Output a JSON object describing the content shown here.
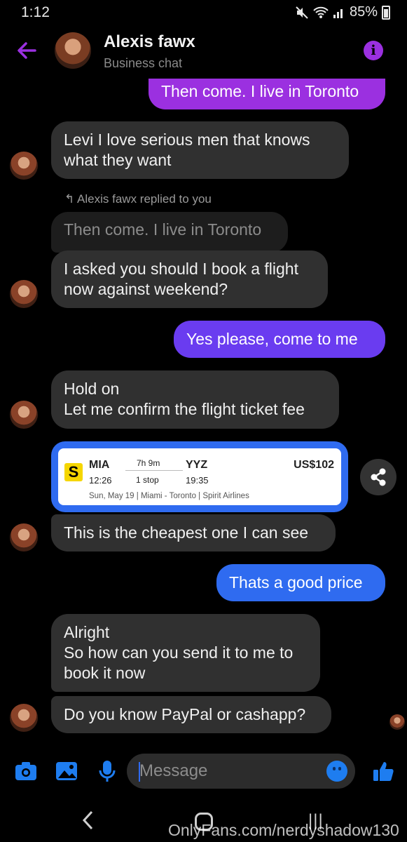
{
  "status_bar": {
    "time": "1:12",
    "battery": "85%"
  },
  "header": {
    "name": "Alexis fawx",
    "subtitle": "Business chat"
  },
  "messages": [
    {
      "text": "Then come. I live in Toronto",
      "dir": "out"
    },
    {
      "text": "Levi I love serious men that knows what they want",
      "dir": "in"
    },
    {
      "reply_note": "Alexis fawx replied to you",
      "quoted": "Then come. I live in Toronto",
      "text": "I asked you should I book a flight now against weekend?",
      "dir": "in"
    },
    {
      "text": "Yes please,  come to me",
      "dir": "out"
    },
    {
      "text_line1": "Hold on",
      "text_line2": "Let me confirm the flight ticket fee",
      "dir": "in"
    },
    {
      "text": "This is the cheapest one I can see",
      "dir": "in"
    },
    {
      "text": "Thats a good price",
      "dir": "out"
    },
    {
      "text_line1": "Alright",
      "text_line2": "So how can you send it to me to book it now",
      "dir": "in"
    },
    {
      "text": "Do you know PayPal or cashapp?",
      "dir": "in"
    }
  ],
  "flight_card": {
    "airline_logo": "S",
    "from": "MIA",
    "depart": "12:26",
    "duration": "7h 9m",
    "stops": "1 stop",
    "to": "YYZ",
    "arrive": "19:35",
    "price": "US$102",
    "details": "Sun, May 19  |  Miami - Toronto  |  Spirit Airlines"
  },
  "composer": {
    "placeholder": "Message"
  },
  "watermark": "OnlyFans.com/nerdyshadow130",
  "colors": {
    "purple": "#9b30e0",
    "violet": "#6a3cf0",
    "blue": "#2f6bf0",
    "incoming": "#303030"
  },
  "icons": [
    "back-arrow-icon",
    "info-icon",
    "share-icon",
    "camera-icon",
    "image-icon",
    "mic-icon",
    "emoji-icon",
    "like-icon"
  ]
}
